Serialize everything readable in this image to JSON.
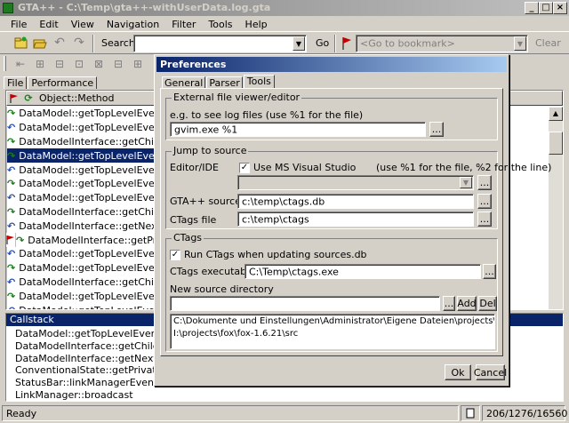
{
  "window": {
    "title": "GTA++  -  C:\\Temp\\gta++-withUserData.log.gta",
    "caption_buttons": [
      "_",
      "□",
      "×"
    ]
  },
  "menu": [
    "File",
    "Edit",
    "View",
    "Navigation",
    "Filter",
    "Tools",
    "Help"
  ],
  "toolbar": {
    "search_label": "Search",
    "search_value": "",
    "go_label": "Go",
    "bookmark_placeholder": "<Go to bookmark>",
    "clear_label": "Clear"
  },
  "left_tabs": [
    "File",
    "Performance"
  ],
  "list": {
    "column_header": "Object::Method",
    "rows": [
      {
        "text": "DataModel::getTopLevelEvents",
        "dir": "fwd",
        "flag": false,
        "selected": false
      },
      {
        "text": "DataModel::getTopLevelEvents",
        "dir": "back",
        "flag": false,
        "selected": false
      },
      {
        "text": "DataModelInterface::getChildPositio",
        "dir": "fwd",
        "flag": false,
        "selected": false
      },
      {
        "text": "DataModel::getTopLevelEvents",
        "dir": "fwd",
        "flag": false,
        "selected": true
      },
      {
        "text": "DataModel::getTopLevelEvents",
        "dir": "back",
        "flag": false,
        "selected": false
      },
      {
        "text": "DataModel::getTopLevelEvents",
        "dir": "fwd",
        "flag": false,
        "selected": false
      },
      {
        "text": "DataModel::getTopLevelEvents",
        "dir": "back",
        "flag": false,
        "selected": false
      },
      {
        "text": "DataModelInterface::getChildPositio",
        "dir": "fwd",
        "flag": false,
        "selected": false
      },
      {
        "text": "DataModelInterface::getNextSiblin",
        "dir": "back",
        "flag": false,
        "selected": false
      },
      {
        "text": "DataModelInterface::getPrevSibling",
        "dir": "fwd",
        "flag": true,
        "selected": false
      },
      {
        "text": "DataModel::getTopLevelEvents",
        "dir": "back",
        "flag": false,
        "selected": false
      },
      {
        "text": "DataModel::getTopLevelEvents",
        "dir": "fwd",
        "flag": false,
        "selected": false
      },
      {
        "text": "DataModelInterface::getChildPositio",
        "dir": "back",
        "flag": false,
        "selected": false
      },
      {
        "text": "DataModel::getTopLevelEvents",
        "dir": "fwd",
        "flag": false,
        "selected": false
      },
      {
        "text": "DataModel::getTopLevelEvents",
        "dir": "back",
        "flag": false,
        "selected": false
      }
    ]
  },
  "callstack": {
    "title": "Callstack",
    "items": [
      "DataModel::getTopLevelEvents",
      "DataModelInterface::getChildPosition",
      "DataModelInterface::getNextSibling",
      "ConventionalState::getPrivateStatus",
      "StatusBar::linkManagerEventReceived",
      "LinkManager::broadcast"
    ]
  },
  "statusbar": {
    "text": "Ready",
    "counts": "206/1276/16560"
  },
  "prefs": {
    "title": "Preferences",
    "tabs": [
      "General",
      "Parser",
      "Tools"
    ],
    "ext_viewer": {
      "title": "External file viewer/editor",
      "hint": "e.g. to see log files (use %1 for the file)",
      "value": "gvim.exe %1"
    },
    "jump": {
      "title": "Jump to source",
      "editor_label": "Editor/IDE",
      "use_msvs_label": "Use MS Visual Studio",
      "use_msvs_checked": true,
      "hint": "(use %1 for the file, %2 for the line)",
      "editor_value": "",
      "sources_label": "GTA++ sources.db",
      "sources_value": "c:\\temp\\ctags.db",
      "ctags_file_label": "CTags file",
      "ctags_file_value": "c:\\temp\\ctags"
    },
    "ctags": {
      "title": "CTags",
      "run_label": "Run CTags when updating sources.db",
      "run_checked": true,
      "exe_label": "CTags executable",
      "exe_value": "C:\\Temp\\ctags.exe",
      "newdir_label": "New source directory",
      "newdir_value": "",
      "add_label": "Add",
      "del_label": "Del",
      "dirs": [
        "C:\\Dokumente und Einstellungen\\Administrator\\Eigene Dateien\\projects\\sqm-tools\\GTA++\\src",
        "I:\\projects\\fox\\fox-1.6.21\\src"
      ]
    },
    "browse_label": "...",
    "ok_label": "Ok",
    "cancel_label": "Cancel"
  }
}
